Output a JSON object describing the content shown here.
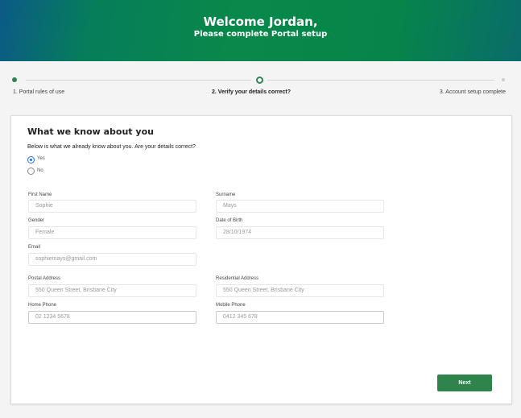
{
  "header": {
    "title": "Welcome Jordan,",
    "subtitle": "Please complete Portal setup"
  },
  "steps": [
    {
      "label": "1. Portal rules of use",
      "state": "complete"
    },
    {
      "label": "2. Verify your details correct?",
      "state": "current"
    },
    {
      "label": "3. Account setup complete",
      "state": "upcoming"
    }
  ],
  "colors": {
    "accent": "#2e844a",
    "radio": "#1a73e8"
  },
  "card": {
    "title": "What we know about you",
    "question": "Below is what we already know about you. Are your details correct?",
    "options": [
      {
        "label": "Yes",
        "selected": true
      },
      {
        "label": "No",
        "selected": false
      }
    ],
    "fields": {
      "first_name": {
        "label": "First Name",
        "value": "Sophie"
      },
      "surname": {
        "label": "Surname",
        "value": "Mays"
      },
      "gender": {
        "label": "Gender",
        "value": "Female"
      },
      "dob": {
        "label": "Date of Birth",
        "value": "28/10/1974"
      },
      "email": {
        "label": "Email",
        "value": "sophiemays@gmail.com"
      },
      "postal": {
        "label": "Postal Address",
        "value": "550 Queen Street, Brisbane City"
      },
      "residential": {
        "label": "Residential Address",
        "value": "550 Queen Street, Brisbane City"
      },
      "home_phone": {
        "label": "Home Phone",
        "value": "02 1234 5678"
      },
      "mobile_phone": {
        "label": "Mobile Phone",
        "value": "0412 345 678"
      }
    },
    "next_label": "Next"
  }
}
